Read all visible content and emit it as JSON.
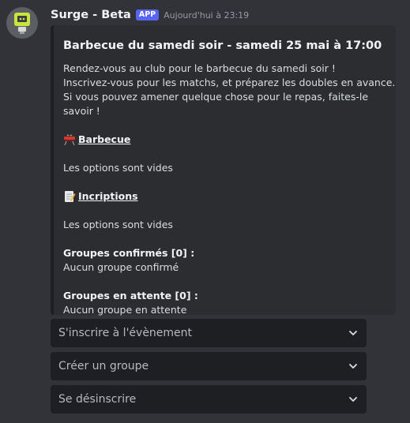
{
  "message": {
    "bot_name": "Surge - Beta",
    "badge": "APP",
    "timestamp": "Aujourd'hui à 23:19"
  },
  "embed": {
    "title": "Barbecue du samedi soir - samedi 25 mai à 17:00",
    "description_lines": [
      "Rendez-vous au club pour le barbecue du samedi soir !",
      "Inscrivez-vous pour les matchs, et préparez les doubles en avance.",
      "Si vous pouvez amener quelque chose pour le repas, faites-le savoir !"
    ],
    "sections": [
      {
        "icon": "grill-icon",
        "title": "Barbecue",
        "value": "Les options sont vides"
      },
      {
        "icon": "memo-icon",
        "title": "Incriptions",
        "value": "Les options sont vides"
      }
    ],
    "groups": [
      {
        "title": "Groupes confirmés [0] :",
        "value": "Aucun groupe confirmé"
      },
      {
        "title": "Groupes en attente [0] :",
        "value": "Aucun groupe en attente"
      }
    ]
  },
  "selects": [
    {
      "label": "S'inscrire à l'évènement"
    },
    {
      "label": "Créer un groupe"
    },
    {
      "label": "Se désinscrire"
    }
  ],
  "colors": {
    "background": "#313338",
    "embed_bg": "#2b2d31",
    "select_bg": "#1e1f22",
    "badge": "#5865f2"
  }
}
